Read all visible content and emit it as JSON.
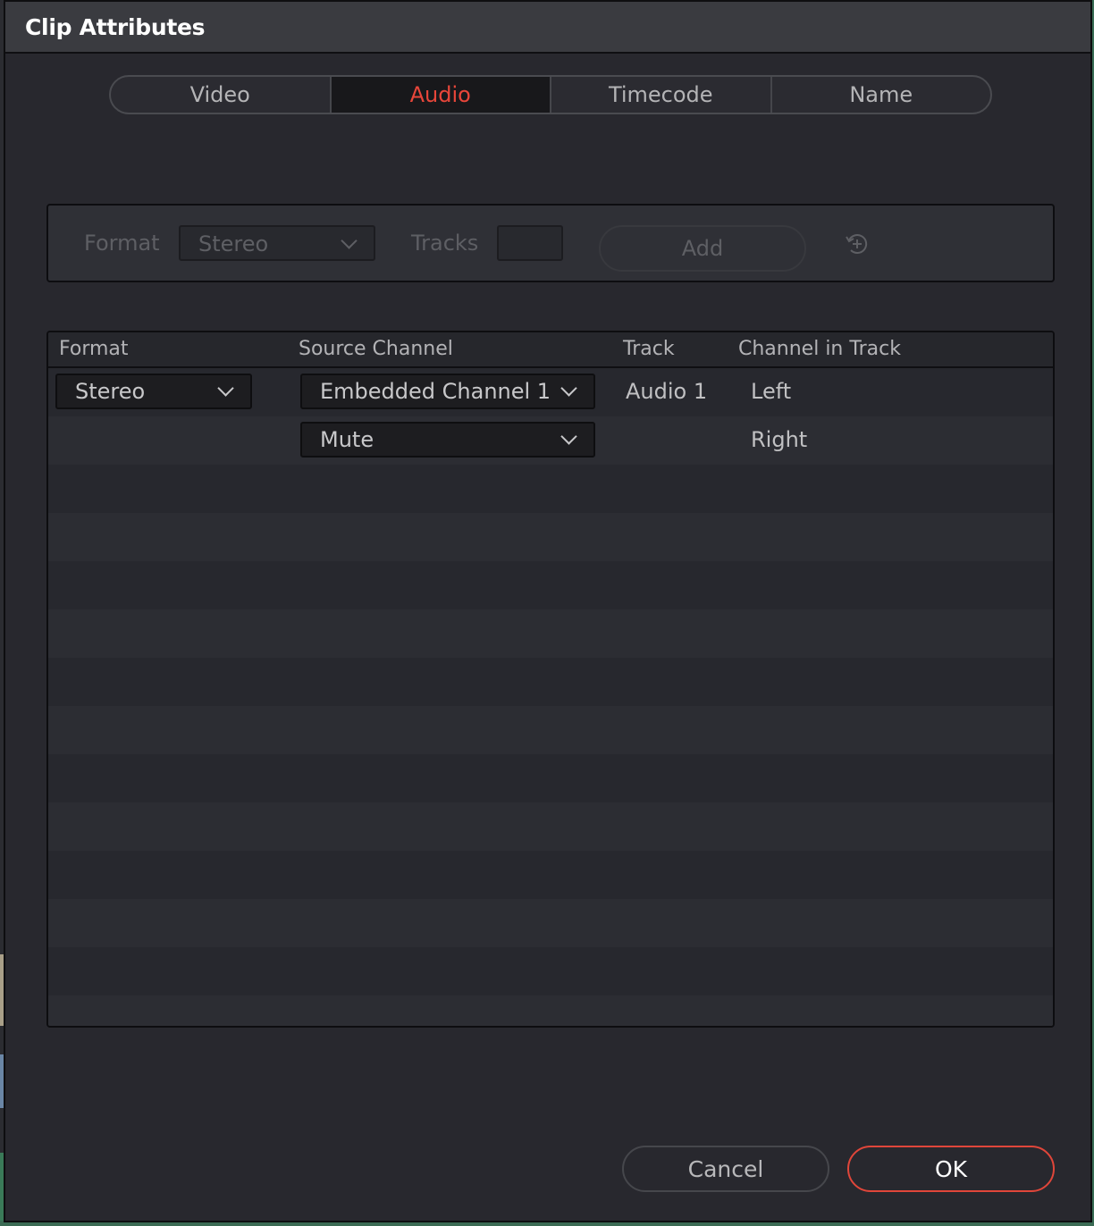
{
  "window": {
    "title": "Clip Attributes"
  },
  "tabs": [
    {
      "label": "Video",
      "active": false
    },
    {
      "label": "Audio",
      "active": true
    },
    {
      "label": "Timecode",
      "active": false
    },
    {
      "label": "Name",
      "active": false
    }
  ],
  "add_bar": {
    "format_label": "Format",
    "format_value": "Stereo",
    "tracks_label": "Tracks",
    "tracks_value": "",
    "add_label": "Add",
    "reset_icon": "reset-add-icon",
    "disabled": true
  },
  "table": {
    "headers": [
      "Format",
      "Source Channel",
      "Track",
      "Channel in Track"
    ],
    "rows": [
      {
        "format": "Stereo",
        "source_channel": "Embedded Channel 1",
        "track": "Audio 1",
        "channel_in_track": "Left"
      },
      {
        "format": "",
        "source_channel": "Mute",
        "track": "",
        "channel_in_track": "Right"
      }
    ]
  },
  "footer": {
    "cancel_label": "Cancel",
    "ok_label": "OK"
  },
  "colors": {
    "accent": "#e8463a",
    "background": "#28282e",
    "titlebar": "#3a3b40"
  }
}
